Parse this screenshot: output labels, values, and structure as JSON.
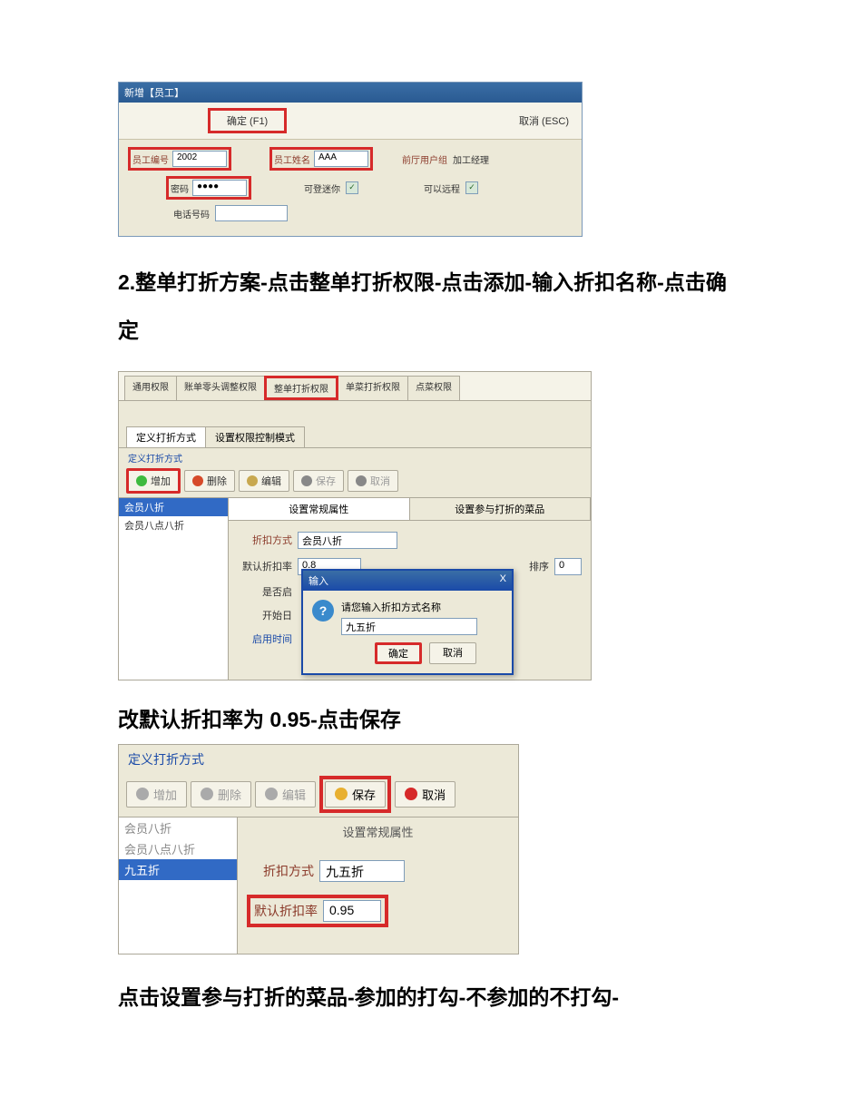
{
  "ss1": {
    "title": "新增【员工】",
    "ok": "确定 (F1)",
    "cancel": "取消 (ESC)",
    "emp_id_lbl": "员工编号",
    "emp_id_val": "2002",
    "emp_name_lbl": "员工姓名",
    "emp_name_val": "AAA",
    "front_user_lbl": "前厅用户组",
    "front_user_val": "加工经理",
    "pwd_lbl": "密码",
    "pwd_val": "●●●●",
    "can_mix_lbl": "可登迷你",
    "can_remote_lbl": "可以远程",
    "phone_lbl": "电话号码"
  },
  "heading1": "2.整单打折方案-点击整单打折权限-点击添加-输入折扣名称-点击确定",
  "ss2": {
    "tabs": [
      "通用权限",
      "账单零头调整权限",
      "整单打折权限",
      "单菜打折权限",
      "点菜权限"
    ],
    "subtabs": [
      "定义打折方式",
      "设置权限控制模式"
    ],
    "group_label": "定义打折方式",
    "btns": {
      "add": "增加",
      "del": "删除",
      "edit": "编辑",
      "save": "保存",
      "cancel": "取消"
    },
    "list": [
      "会员八折",
      "会员八点八折"
    ],
    "proptabs": [
      "设置常规属性",
      "设置参与打折的菜品"
    ],
    "form": {
      "discount_type_lbl": "折扣方式",
      "discount_type_val": "会员八折",
      "default_rate_lbl": "默认折扣率",
      "default_rate_val": "0.8",
      "sort_lbl": "排序",
      "sort_val": "0",
      "enable_lbl": "是否启",
      "start_date_lbl": "开始日",
      "enable_time_lbl": "启用时间"
    },
    "dialog": {
      "title": "输入",
      "msg": "请您输入折扣方式名称",
      "input": "九五折",
      "ok": "确定",
      "cancel": "取消",
      "close": "X"
    }
  },
  "heading2": "改默认折扣率为 0.95-点击保存",
  "ss3": {
    "title": "定义打折方式",
    "btns": {
      "add": "增加",
      "del": "删除",
      "edit": "编辑",
      "save": "保存",
      "cancel": "取消"
    },
    "list": [
      "会员八折",
      "会员八点八折",
      "九五折"
    ],
    "proptab": "设置常规属性",
    "discount_type_lbl": "折扣方式",
    "discount_type_val": "九五折",
    "default_rate_lbl": "默认折扣率",
    "default_rate_val": "0.95"
  },
  "heading3": "点击设置参与打折的菜品-参加的打勾-不参加的不打勾-"
}
